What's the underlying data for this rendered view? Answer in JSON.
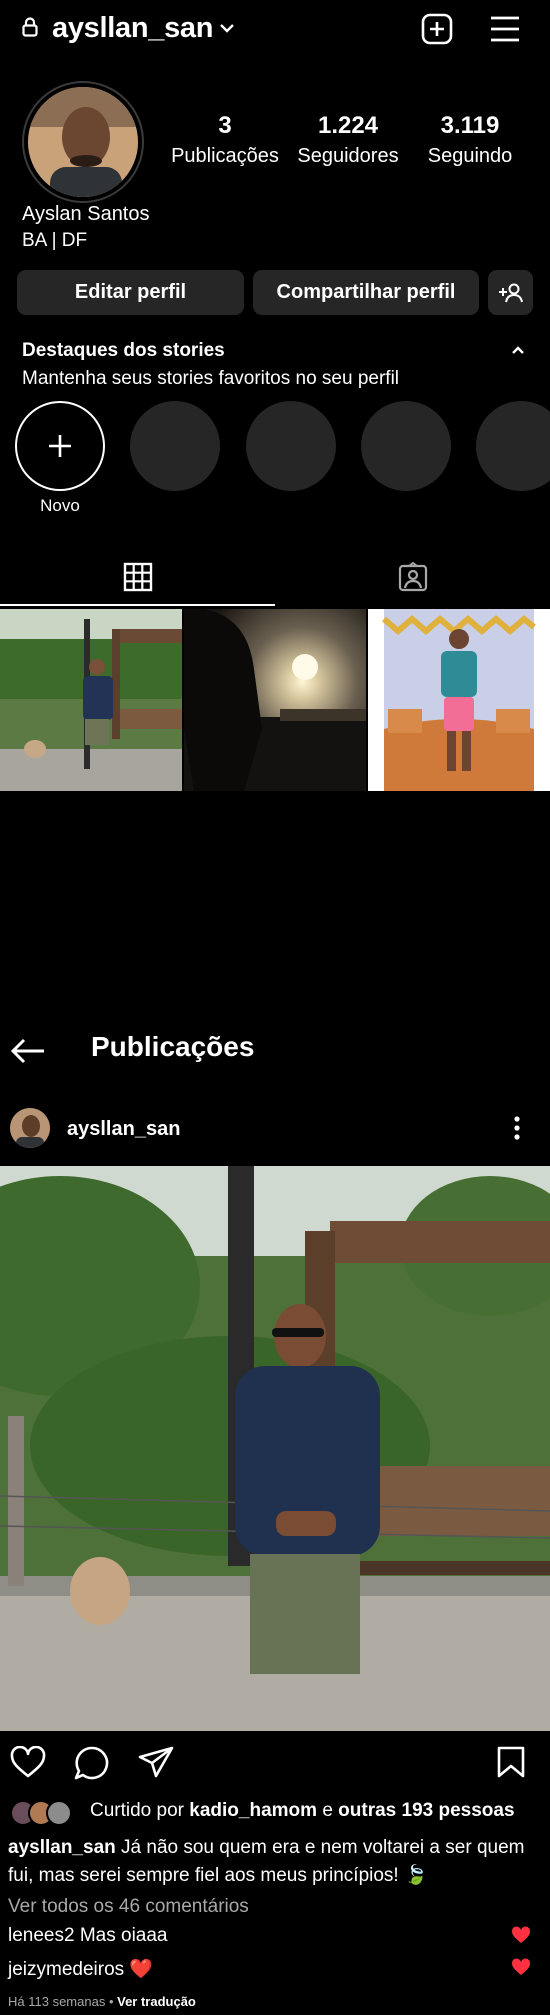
{
  "topbar": {
    "username": "aysllan_san",
    "icons": [
      "lock-icon",
      "chevron-down-icon",
      "new-post-icon",
      "menu-icon"
    ]
  },
  "profile": {
    "stats": [
      {
        "value": "3",
        "label": "Publicações"
      },
      {
        "value": "1.224",
        "label": "Seguidores"
      },
      {
        "value": "3.119",
        "label": "Seguindo"
      }
    ],
    "full_name": "Ayslan Santos",
    "bio": "BA | DF"
  },
  "buttons": {
    "edit": "Editar perfil",
    "share": "Compartilhar perfil"
  },
  "highlights": {
    "title": "Destaques dos stories",
    "subtitle": "Mantenha seus stories favoritos no seu perfil",
    "new_label": "Novo"
  },
  "post_view": {
    "title": "Publicações",
    "username": "aysllan_san",
    "liked": {
      "prefix": "Curtido por ",
      "user": "kadio_hamom",
      "middle": " e ",
      "others": "outras 193 pessoas"
    },
    "caption": {
      "user": "aysllan_san",
      "text": " Já não sou quem era e nem voltarei a ser quem fui, mas serei sempre fiel aos meus princípios! 🍃"
    },
    "view_all": "Ver todos os 46 comentários",
    "comments": [
      {
        "user": "lenees2",
        "text": " Mas oiaaa"
      },
      {
        "user": "jeizymedeiros",
        "text": " ❤️"
      }
    ],
    "time": "Há 113 semanas",
    "separator": " • ",
    "translate": "Ver tradução"
  },
  "colors": {
    "background": "#000000",
    "button": "#262626",
    "muted_text": "#a8a8a8",
    "like_red": "#ff3040"
  }
}
